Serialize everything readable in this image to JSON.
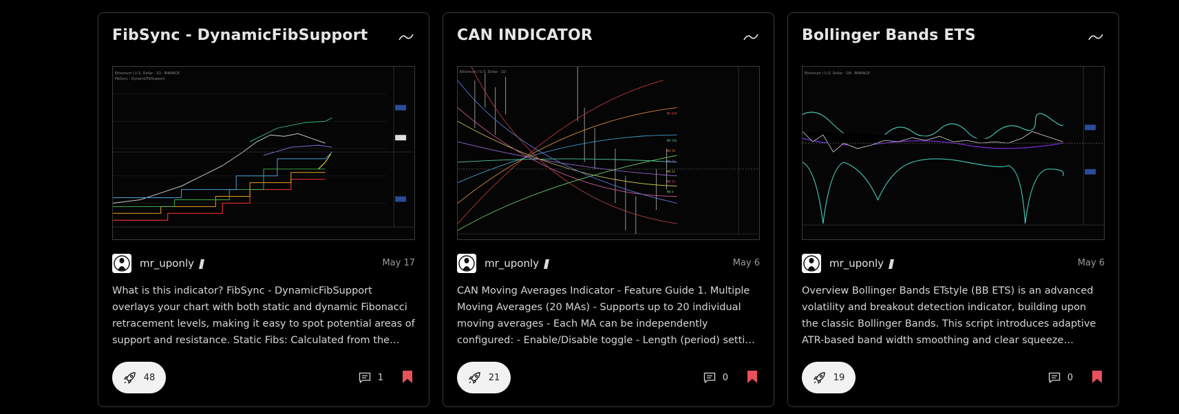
{
  "colors": {
    "background": "#000000",
    "card_border": "#3a3a3a",
    "bookmark": "#e8505b",
    "boost_bg": "#f2f2f2"
  },
  "cards": [
    {
      "title": "FibSync - DynamicFibSupport",
      "author": "mr_uponly",
      "date": "May 17",
      "description": "What is this indicator? FibSync - DynamicFibSupport overlays your chart with both static and dynamic Fibonacci retracement levels, making it easy to spot potential areas of support and resistance. Static Fibs: Calculated from the highest and lowest...",
      "boosts": "48",
      "comments": "1",
      "icons": [
        "trend-icon",
        "rocket-icon",
        "comment-icon",
        "bookmark-icon",
        "pencil-icon"
      ]
    },
    {
      "title": "CAN INDICATOR",
      "author": "mr_uponly",
      "date": "May 6",
      "description": "CAN Moving Averages Indicator - Feature Guide 1. Multiple Moving Averages (20 MAs) - Supports up to 20 individual moving averages - Each MA can be independently configured: - Enable/Disable toggle - Length (period) setting - Type selection...",
      "boosts": "21",
      "comments": "0",
      "icons": [
        "trend-icon",
        "rocket-icon",
        "comment-icon",
        "bookmark-icon",
        "pencil-icon"
      ]
    },
    {
      "title": "Bollinger Bands ETS",
      "author": "mr_uponly",
      "date": "May 6",
      "description": "Overview Bollinger Bands ETstyle (BB ETS) is an advanced volatility and breakout detection indicator, building upon the classic Bollinger Bands. This script introduces adaptive ATR-based band width smoothing and clear squeeze detection,...",
      "boosts": "19",
      "comments": "0",
      "icons": [
        "trend-icon",
        "rocket-icon",
        "comment-icon",
        "bookmark-icon",
        "pencil-icon"
      ]
    }
  ]
}
